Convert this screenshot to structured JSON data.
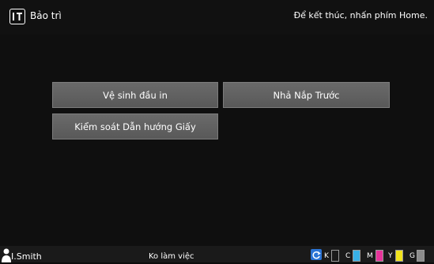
{
  "header": {
    "title": "Bảo trì",
    "hint": "Để kết thúc, nhấn phím Home.",
    "icon": "maintenance-icon"
  },
  "main": {
    "buttons": [
      {
        "id": "clean",
        "label": "Vệ sinh đầu in"
      },
      {
        "id": "release",
        "label": "Nhả Nắp Trước"
      },
      {
        "id": "paper",
        "label": "Kiểm soát Dẫn hướng Giấy"
      }
    ]
  },
  "footer": {
    "user": "I.Smith",
    "status": "Ko làm việc",
    "inks": [
      {
        "label": "K",
        "color": "#1a1a1a",
        "level": 0
      },
      {
        "label": "C",
        "color": "#38b0e6",
        "level": 1.0
      },
      {
        "label": "M",
        "color": "#e6339a",
        "level": 1.0
      },
      {
        "label": "Y",
        "color": "#f2e41c",
        "level": 1.0
      },
      {
        "label": "G",
        "color": "#8c8c8c",
        "level": 1.0
      }
    ]
  }
}
